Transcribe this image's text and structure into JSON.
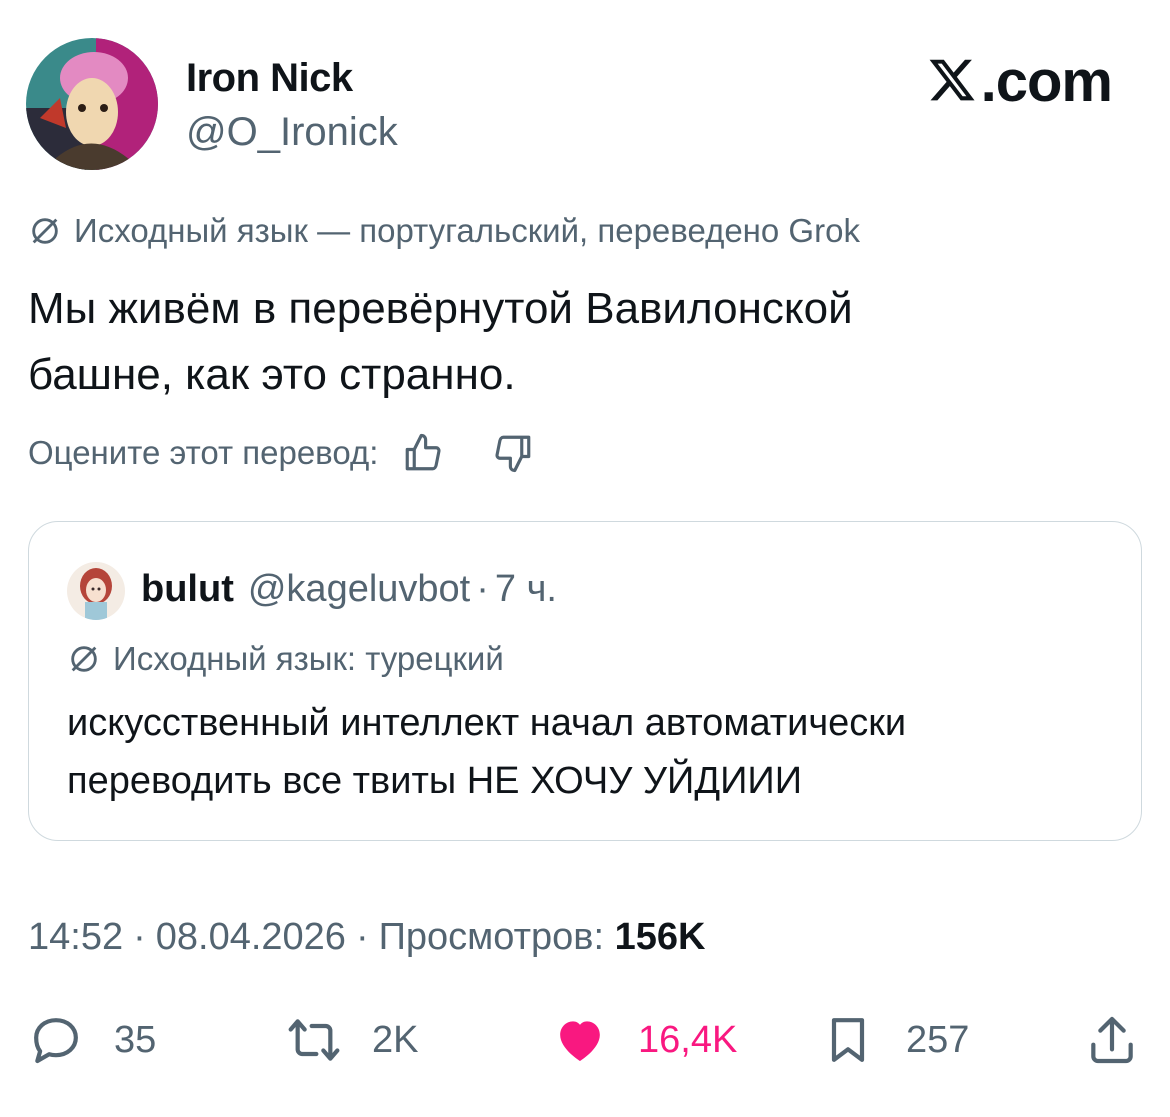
{
  "author": {
    "display_name": "Iron Nick",
    "handle": "@O_Ironick",
    "avatar_icon": "avatar-illustration"
  },
  "brand": {
    "text": ".com",
    "logo_icon": "x-logo-icon"
  },
  "translation_note": "Исходный язык — португальский, переведено Grok",
  "tweet": {
    "lines": [
      "Мы живём в перевёрнутой Вавилонской",
      "башне, как это странно."
    ]
  },
  "rate": {
    "label": "Оцените этот перевод:",
    "up_icon": "thumbs-up-icon",
    "down_icon": "thumbs-down-icon"
  },
  "quote": {
    "name": "bulut",
    "handle": "@kageluvbot",
    "dot": "·",
    "time": "7 ч.",
    "note": "Исходный язык: турецкий",
    "lines": [
      "искусственный интеллект начал автоматически",
      "переводить все твиты НЕ ХОЧУ УЙДИИИ"
    ]
  },
  "meta": {
    "time": "14:52",
    "date": "08.04.2026",
    "views_label": "Просмотров:",
    "views_value": "156K",
    "separator": "·"
  },
  "actions": {
    "replies": "35",
    "reposts": "2K",
    "likes": "16,4K",
    "bookmarks": "257"
  },
  "colors": {
    "text": "#0f1419",
    "secondary": "#536471",
    "like": "#f91880",
    "border": "#cfd9de"
  }
}
